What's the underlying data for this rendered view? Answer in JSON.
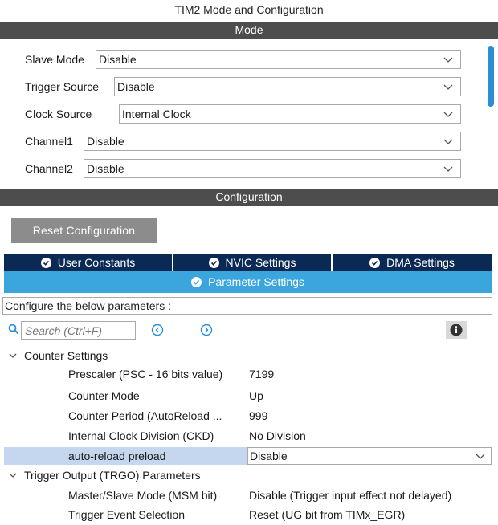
{
  "window": {
    "title": "TIM2 Mode and Configuration"
  },
  "sections": {
    "mode": "Mode",
    "configuration": "Configuration"
  },
  "mode_fields": [
    {
      "label": "Slave Mode",
      "value": "Disable"
    },
    {
      "label": "Trigger Source",
      "value": "Disable"
    },
    {
      "label": "Clock Source",
      "value": "Internal Clock"
    },
    {
      "label": "Channel1",
      "value": "Disable"
    },
    {
      "label": "Channel2",
      "value": "Disable"
    }
  ],
  "config": {
    "reset_label": "Reset Configuration",
    "tabs": [
      "User Constants",
      "NVIC Settings",
      "DMA Settings"
    ],
    "active_tab": "Parameter Settings",
    "description": "Configure the below parameters :",
    "search_placeholder": "Search (Ctrl+F)"
  },
  "params": {
    "counter_group": "Counter Settings",
    "counter": [
      {
        "name": "Prescaler (PSC - 16 bits value)",
        "value": "7199"
      },
      {
        "name": "Counter Mode",
        "value": "Up"
      },
      {
        "name": "Counter Period (AutoReload ...",
        "value": "999"
      },
      {
        "name": "Internal Clock Division (CKD)",
        "value": "No Division"
      },
      {
        "name": "auto-reload preload",
        "value": "Disable"
      }
    ],
    "trgo_group": "Trigger Output (TRGO) Parameters",
    "trgo": [
      {
        "name": "Master/Slave Mode (MSM bit)",
        "value": "Disable (Trigger input effect not delayed)"
      },
      {
        "name": "Trigger Event Selection",
        "value": "Reset (UG bit from TIMx_EGR)"
      }
    ]
  },
  "colors": {
    "section_bar": "#4d4d4d",
    "tab_dark": "#0a2a55",
    "tab_active": "#3aa6dd",
    "selected_row": "#c4d7ee",
    "scrollbar": "#2a8fd6"
  }
}
